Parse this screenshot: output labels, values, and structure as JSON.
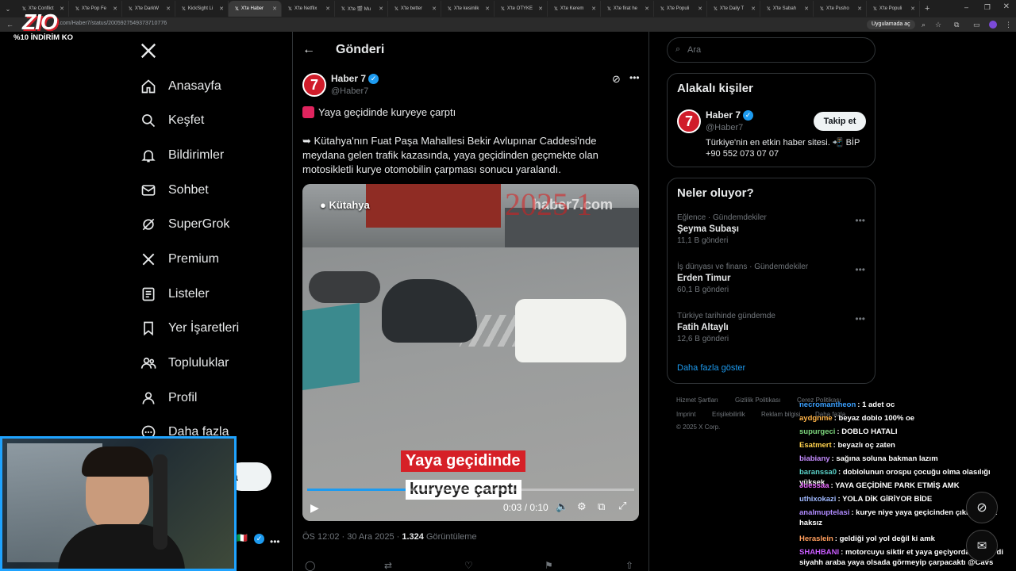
{
  "overlay_brand": {
    "logo": "ZIO",
    "promo": "%10 İNDİRİM KO"
  },
  "browser": {
    "tabs": [
      {
        "label": "X'te Conflict"
      },
      {
        "label": "X'te Pop Fe"
      },
      {
        "label": "X'te DarkW"
      },
      {
        "label": "KickSight Li"
      },
      {
        "label": "X'te Haber",
        "active": true
      },
      {
        "label": "X'te Netflix"
      },
      {
        "label": "X'te 🎬 Mu"
      },
      {
        "label": "X'te better"
      },
      {
        "label": "X'te kesinlik"
      },
      {
        "label": "X'te OTYKE"
      },
      {
        "label": "X'te Kerem"
      },
      {
        "label": "X'te firat he"
      },
      {
        "label": "X'te Populi"
      },
      {
        "label": "X'te Daily T"
      },
      {
        "label": "X'te Sabah"
      },
      {
        "label": "X'te Pusho"
      },
      {
        "label": "X'te Populi"
      }
    ],
    "url": "x.com/Haber7/status/2005927549373710776",
    "app_button": "Uygulamada aç"
  },
  "nav": {
    "items": [
      {
        "label": "Anasayfa",
        "icon": "home-icon"
      },
      {
        "label": "Keşfet",
        "icon": "search-icon"
      },
      {
        "label": "Bildirimler",
        "icon": "bell-icon"
      },
      {
        "label": "Sohbet",
        "icon": "mail-icon"
      },
      {
        "label": "SuperGrok",
        "icon": "grok-icon"
      },
      {
        "label": "Premium",
        "icon": "x-logo-icon"
      },
      {
        "label": "Listeler",
        "icon": "list-icon"
      },
      {
        "label": "Yer İşaretleri",
        "icon": "bookmark-icon"
      },
      {
        "label": "Topluluklar",
        "icon": "people-icon"
      },
      {
        "label": "Profil",
        "icon": "person-icon"
      },
      {
        "label": "Daha fazla",
        "icon": "more-circle-icon"
      }
    ],
    "post_button_partial": "a"
  },
  "post": {
    "header_title": "Gönderi",
    "author_name": "Haber 7",
    "author_handle": "@Haber7",
    "headline": "Yaya geçidinde kuryeye çarptı",
    "body": "➥ Kütahya'nın Fuat Paşa Mahallesi Bekir Avlupınar Caddesi'nde meydana gelen trafik kazasında, yaya geçidinden geçmekte olan motosikletli kurye otomobilin çarpması sonucu yaralandı.",
    "video": {
      "location_tag": "Kütahya",
      "watermark": "haber7.com",
      "year_overlay": "2025 1",
      "caption_line1": "Yaya geçidinde",
      "caption_line2": "kuryeye çarptı",
      "time": "0:03 / 0:10",
      "progress": 0.3
    },
    "meta_time": "ÖS 12:02 · 30 Ara 2025 ·",
    "views_count": "1.324",
    "views_label": "Görüntüleme"
  },
  "right": {
    "search_placeholder": "Ara",
    "related_title": "Alakalı kişiler",
    "related": {
      "name": "Haber 7",
      "handle": "@Haber7",
      "follow": "Takip et",
      "bio": "Türkiye'nin en etkin haber sitesi. 📲 BİP +90 552 073 07 07"
    },
    "trends_title": "Neler oluyor?",
    "trends": [
      {
        "category": "Eğlence · Gündemdekiler",
        "name": "Şeyma Subaşı",
        "count": "11,1 B gönderi"
      },
      {
        "category": "İş dünyası ve finans · Gündemdekiler",
        "name": "Erden Timur",
        "count": "60,1 B gönderi"
      },
      {
        "category": "Türkiye tarihinde gündemde",
        "name": "Fatih Altaylı",
        "count": "12,6 B gönderi"
      }
    ],
    "show_more": "Daha fazla göster",
    "footer": [
      "Hizmet Şartları",
      "Gizlilik Politikası",
      "Çerez Politikası",
      "Imprint",
      "Erişilebilirlik",
      "Reklam bilgisi",
      "Daha fazla",
      "© 2025 X Corp."
    ]
  },
  "chat": [
    {
      "user": "necromantheon",
      "color": "#3aa0ff",
      "msg": ": 1 adet oc"
    },
    {
      "user": "aydgnme",
      "color": "#ffb347",
      "msg": ": beyaz doblo 100% oe"
    },
    {
      "user": "supurgeci",
      "color": "#7cd67c",
      "msg": ": DOBLO HATALI"
    },
    {
      "user": "Esatmert",
      "color": "#ffd24d",
      "msg": ": beyazlı oç zaten"
    },
    {
      "user": "biabiany",
      "color": "#c48bff",
      "msg": ": sağına soluna bakman lazım"
    },
    {
      "user": "baranssa0",
      "color": "#5ad1c8",
      "msg": ": doblolunun orospu çocuğu olma olasılığı yüksek"
    },
    {
      "user": "Juessaa",
      "color": "#e86bff",
      "msg": ": YAYA GEÇİDİNE PARK ETMİŞ AMK"
    },
    {
      "user": "uthixokazi",
      "color": "#9fb8ff",
      "msg": ": YOLA DİK GİRİYOR BİDE"
    },
    {
      "user": "analmuptelasi",
      "color": "#b08bff",
      "msg": ": kurye niye yaya geçicinden çıkıyor amk haksız"
    },
    {
      "user": "Heraslein",
      "color": "#ff9d5c",
      "msg": ": geldiği yol yol değil ki amk"
    },
    {
      "user": "SHAHBANI",
      "color": "#c95cff",
      "msg": ": motorcuyu siktir et yaya geçiyorda olabilirdi siyahh araba yaya olsada görmeyip çarpacaktı @Cavs"
    }
  ]
}
